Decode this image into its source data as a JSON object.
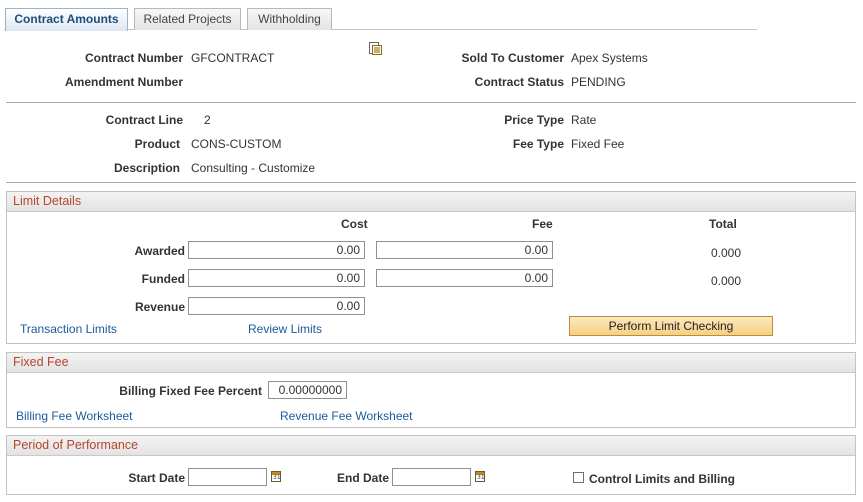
{
  "tabs": [
    {
      "label": "Contract Amounts",
      "active": true
    },
    {
      "label": "Related Projects",
      "active": false
    },
    {
      "label": "Withholding",
      "active": false
    }
  ],
  "header": {
    "contract_number_label": "Contract Number",
    "contract_number": "GFCONTRACT",
    "amendment_number_label": "Amendment Number",
    "amendment_number": "",
    "sold_to_label": "Sold To Customer",
    "sold_to": "Apex Systems",
    "status_label": "Contract Status",
    "status": "PENDING",
    "document_icon": "document-detail-icon"
  },
  "line": {
    "contract_line_label": "Contract Line",
    "contract_line": "2",
    "product_label": "Product",
    "product": "CONS-CUSTOM",
    "description_label": "Description",
    "description": "Consulting - Customize",
    "price_type_label": "Price Type",
    "price_type": "Rate",
    "fee_type_label": "Fee Type",
    "fee_type": "Fixed Fee"
  },
  "limit_details": {
    "title": "Limit Details",
    "col_cost": "Cost",
    "col_fee": "Fee",
    "col_total": "Total",
    "awarded_label": "Awarded",
    "awarded_cost": "0.00",
    "awarded_fee": "0.00",
    "awarded_total": "0.000",
    "funded_label": "Funded",
    "funded_cost": "0.00",
    "funded_fee": "0.00",
    "funded_total": "0.000",
    "revenue_label": "Revenue",
    "revenue_cost": "0.00",
    "transaction_limits_link": "Transaction Limits",
    "review_limits_link": "Review Limits",
    "perform_button": "Perform Limit Checking"
  },
  "fixed_fee": {
    "title": "Fixed Fee",
    "percent_label": "Billing Fixed Fee Percent",
    "percent": "0.00000000",
    "billing_link": "Billing Fee Worksheet",
    "revenue_link": "Revenue Fee Worksheet"
  },
  "period": {
    "title": "Period of Performance",
    "start_label": "Start Date",
    "start": "",
    "end_label": "End Date",
    "end": "",
    "control_label": "Control Limits and Billing",
    "control_checked": false
  },
  "colors": {
    "section_title": "#b5462b",
    "link": "#1a5a9c",
    "button": "#f6cf83"
  }
}
